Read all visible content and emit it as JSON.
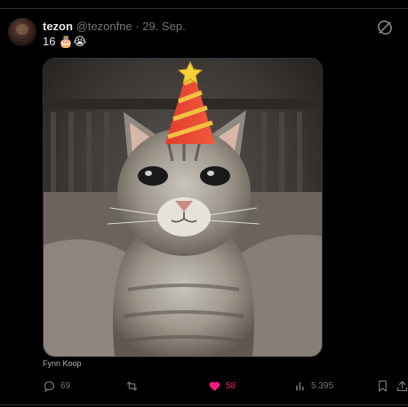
{
  "tweet": {
    "display_name": "tezon",
    "handle": "@tezonfne",
    "separator": "·",
    "date": "29. Sep.",
    "text": "16 🎂😭",
    "media_caption": "Fynn Koop"
  },
  "actions": {
    "replies": "69",
    "reposts": "",
    "likes": "58",
    "views": "5.395"
  },
  "icons": [
    "grok-icon",
    "reply-icon",
    "repost-icon",
    "like-icon",
    "views-icon",
    "bookmark-icon",
    "share-icon"
  ],
  "colors": {
    "background": "#000000",
    "text": "#e7e9ea",
    "muted": "#71767b",
    "like": "#f91880",
    "divider": "#2f3336"
  }
}
